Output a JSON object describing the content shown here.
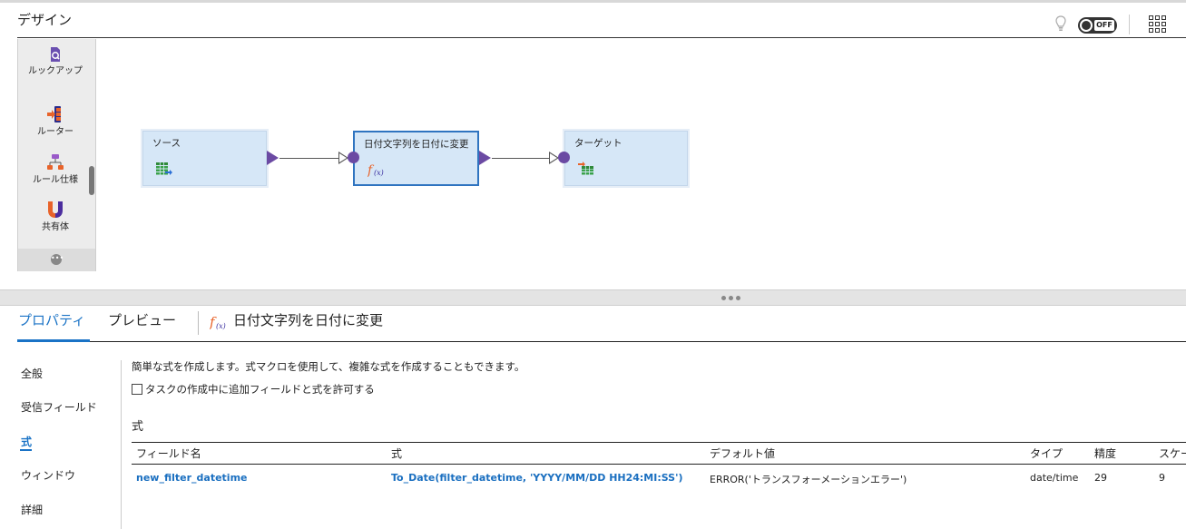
{
  "design": {
    "title": "デザイン",
    "toggle_label": "OFF",
    "icons": [
      "lightbulb-icon",
      "toggle-switch",
      "app-grid-icon"
    ]
  },
  "palette": {
    "items": [
      {
        "label": "ルックアップ",
        "icon": "lookup-icon"
      },
      {
        "label": "ルーター",
        "icon": "router-icon"
      },
      {
        "label": "ルール仕様",
        "icon": "rule-spec-icon"
      },
      {
        "label": "共有体",
        "icon": "union-icon"
      }
    ],
    "more_icon": "more-icon"
  },
  "canvas": {
    "nodes": [
      {
        "label": "ソース",
        "icon": "source-table-icon"
      },
      {
        "label": "日付文字列を日付に変更",
        "icon": "expression-fx-icon",
        "selected": true
      },
      {
        "label": "ターゲット",
        "icon": "target-table-icon"
      }
    ]
  },
  "panel": {
    "tabs": [
      {
        "label": "プロパティ",
        "active": true
      },
      {
        "label": "プレビュー",
        "active": false
      }
    ],
    "object_title": "日付文字列を日付に変更",
    "object_icon": "expression-fx-icon"
  },
  "nav": {
    "items": [
      {
        "label": "全般",
        "active": false
      },
      {
        "label": "受信フィールド",
        "active": false
      },
      {
        "label": "式",
        "active": true
      },
      {
        "label": "ウィンドウ",
        "active": false
      },
      {
        "label": "詳細",
        "active": false
      }
    ]
  },
  "content": {
    "description": "簡単な式を作成します。式マクロを使用して、複雑な式を作成することもできます。",
    "checkbox_label": "タスクの作成中に追加フィールドと式を許可する",
    "checkbox_checked": false,
    "section_title": "式",
    "table": {
      "headers": [
        "フィールド名",
        "式",
        "デフォルト値",
        "タイプ",
        "精度",
        "スケー"
      ],
      "rows": [
        [
          "new_filter_datetime",
          "To_Date(filter_datetime, 'YYYY/MM/DD HH24:MI:SS')",
          "ERROR('トランスフォーメーションエラー')",
          "date/time",
          "29",
          "9"
        ]
      ]
    }
  },
  "colors": {
    "accent": "#1a73c6",
    "node_fill": "#d6e7f7",
    "port": "#6b4aa3"
  }
}
